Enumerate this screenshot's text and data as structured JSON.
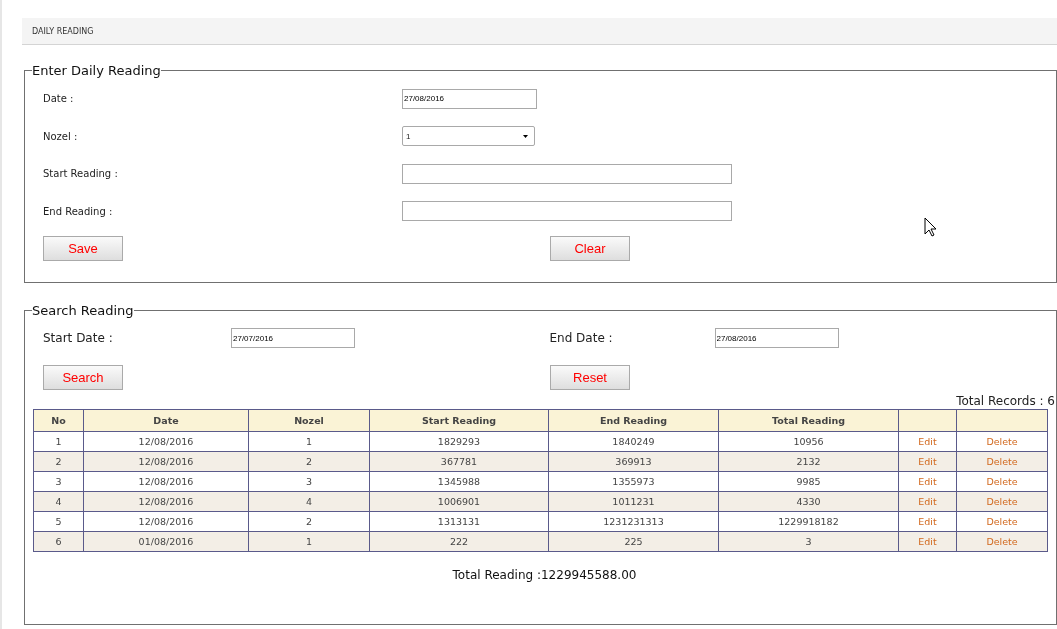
{
  "page_header": {
    "title": "DAILY READING"
  },
  "entry_form": {
    "legend": "Enter Daily Reading",
    "fields": [
      {
        "kind": "text",
        "label": "Date :",
        "value": "27/08/2016"
      },
      {
        "kind": "select",
        "label": "Nozel :",
        "value": "1"
      },
      {
        "kind": "wide",
        "label": "Start Reading :"
      },
      {
        "kind": "wide",
        "label": "End Reading :"
      }
    ],
    "buttons": [
      "Save",
      "Clear"
    ]
  },
  "search_form": {
    "legend": "Search Reading",
    "start_label": "Start Date :",
    "start_value": "27/07/2016",
    "end_label": "End Date :",
    "end_value": "27/08/2016",
    "buttons": [
      "Search",
      "Reset"
    ],
    "total_records": "Total Records : 6"
  },
  "table": {
    "columns": [
      "No",
      "Date",
      "Nozel",
      "Start Reading",
      "End Reading",
      "Total Reading"
    ],
    "rows": [
      {
        "no": "1",
        "date": "12/08/2016",
        "nozel": "1",
        "start": "1829293",
        "end": "1840249",
        "total": "10956",
        "edit": "Edit",
        "delete": "Delete"
      },
      {
        "no": "2",
        "date": "12/08/2016",
        "nozel": "2",
        "start": "367781",
        "end": "369913",
        "total": "2132",
        "edit": "Edit",
        "delete": "Delete"
      },
      {
        "no": "3",
        "date": "12/08/2016",
        "nozel": "3",
        "start": "1345988",
        "end": "1355973",
        "total": "9985",
        "edit": "Edit",
        "delete": "Delete"
      },
      {
        "no": "4",
        "date": "12/08/2016",
        "nozel": "4",
        "start": "1006901",
        "end": "1011231",
        "total": "4330",
        "edit": "Edit",
        "delete": "Delete"
      },
      {
        "no": "5",
        "date": "12/08/2016",
        "nozel": "2",
        "start": "1313131",
        "end": "1231231313",
        "total": "1229918182",
        "edit": "Edit",
        "delete": "Delete"
      },
      {
        "no": "6",
        "date": "01/08/2016",
        "nozel": "1",
        "start": "222",
        "end": "225",
        "total": "3",
        "edit": "Edit",
        "delete": "Delete"
      }
    ]
  },
  "total_reading": "Total Reading :1229945588.00"
}
